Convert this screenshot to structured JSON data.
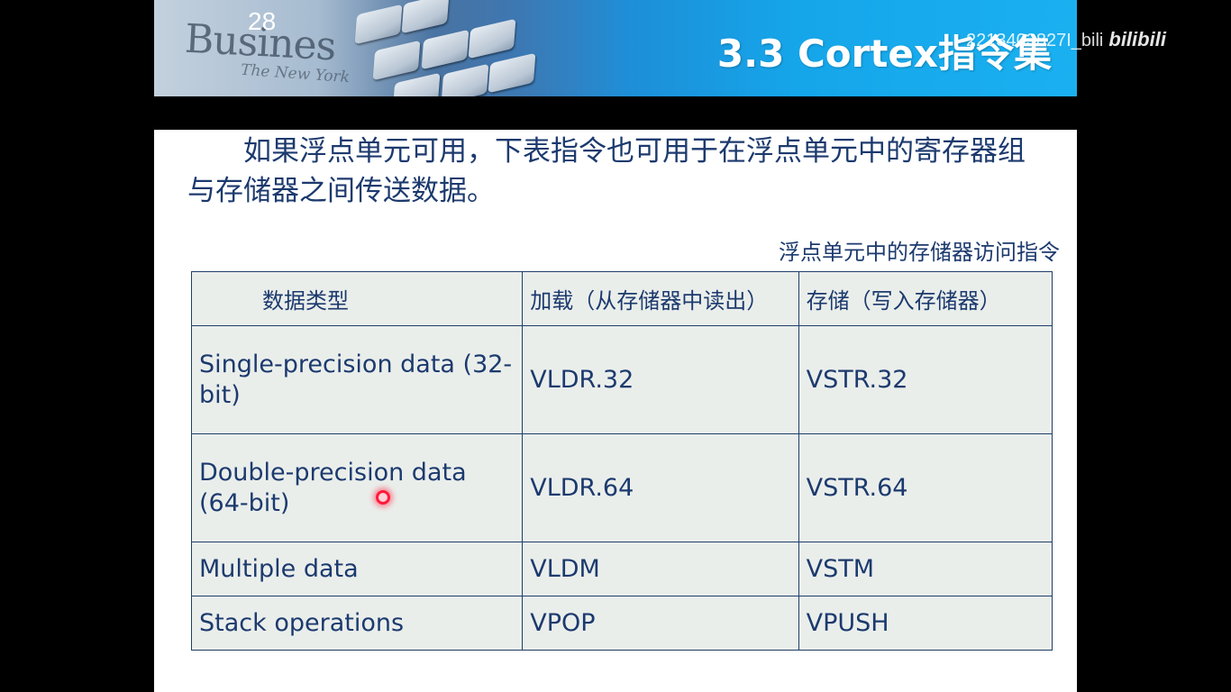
{
  "header": {
    "slide_number": "28",
    "title": "3.3 Cortex指令集",
    "decor_word": "Busines",
    "decor_sub": "The New York"
  },
  "watermark": {
    "user": "2213403827I_bili",
    "logo": "bilibili"
  },
  "body": {
    "intro": "如果浮点单元可用，下表指令也可用于在浮点单元中的寄存器组与存储器之间传送数据。",
    "table_caption": "浮点单元中的存储器访问指令",
    "table": {
      "headers": [
        "数据类型",
        "加载（从存储器中读出）",
        "存储（写入存储器）"
      ],
      "rows": [
        {
          "type": "Single-precision data (32-bit)",
          "load": "VLDR.32",
          "store": "VSTR.32"
        },
        {
          "type": "Double-precision data (64-bit)",
          "load": "VLDR.64",
          "store": "VSTR.64"
        },
        {
          "type": "Multiple data",
          "load": "VLDM",
          "store": "VSTM"
        },
        {
          "type": "Stack operations",
          "load": "VPOP",
          "store": "VPUSH"
        }
      ]
    }
  },
  "colors": {
    "text": "#1c3a6e",
    "table_bg": "#eaeeeb",
    "border": "#1f3f6a",
    "banner_blue": "#15a6ea",
    "cursor": "#ff1a3a"
  }
}
